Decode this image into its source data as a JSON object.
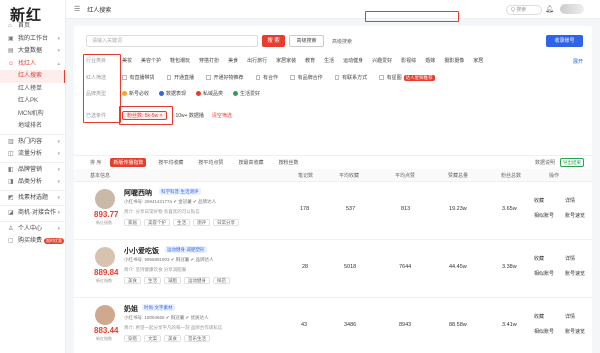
{
  "sidebar": {
    "logo": "新红",
    "items": [
      {
        "label": "首页",
        "icon": "home-icon",
        "caret": ""
      },
      {
        "label": "我的工作台",
        "icon": "desk-icon",
        "caret": "▾"
      },
      {
        "label": "大盘数据",
        "icon": "chart-icon",
        "caret": "▾"
      },
      {
        "label": "找红人",
        "icon": "user-icon",
        "caret": "▴",
        "active": true
      },
      {
        "label": "红人搜索",
        "sub": true,
        "current": true
      },
      {
        "label": "红人榜单",
        "sub": true
      },
      {
        "label": "红人PK",
        "sub": true
      },
      {
        "label": "MCN机构",
        "sub": true
      },
      {
        "label": "地域排名",
        "sub": true
      },
      {
        "label": "热门内容",
        "icon": "doc-icon",
        "caret": "▾"
      },
      {
        "label": "流量分析",
        "icon": "flow-icon",
        "caret": "▾"
      },
      {
        "label": "品牌营销",
        "icon": "brand-icon",
        "caret": "▾"
      },
      {
        "label": "品类分析",
        "icon": "category-icon",
        "caret": "▾"
      },
      {
        "label": "找素材选题",
        "icon": "material-icon",
        "caret": "▾"
      },
      {
        "label": "商机·对接合作",
        "icon": "deal-icon",
        "caret": "▾"
      },
      {
        "label": "个人中心",
        "icon": "person-icon",
        "caret": "▾"
      },
      {
        "label": "购买续费",
        "icon": "cart-icon",
        "caret": "",
        "badge": "限时优惠"
      }
    ]
  },
  "topbar": {
    "crumb": "红人搜索",
    "search_placeholder": "Q 搜索"
  },
  "search": {
    "placeholder": "请输入关键词",
    "search_btn": "搜 索",
    "advanced_btn": "高级搜索",
    "advanced_link": "高级搜索",
    "collect_btn": "收录账号"
  },
  "filters": {
    "industry_label": "行业类目",
    "industry_options": [
      "美妆",
      "美容个护",
      "鞋包潮玩",
      "穿搭打扮",
      "美食",
      "出行旅行",
      "家居家装",
      "教育",
      "生活",
      "运动健身",
      "兴趣爱好",
      "影视综",
      "婚嫁",
      "摄影摄像",
      "家居",
      "情感星座"
    ],
    "industry_more": "展开",
    "advanced_label": "红人筛选",
    "advanced_checks": [
      "有直播带货",
      "开通直播",
      "开通好物推荐",
      "有合作",
      "有品牌合作",
      "有联系方式",
      "有星图"
    ],
    "advanced_tag": "达人星探推荐",
    "platform_label": "品牌类型",
    "platforms": [
      {
        "label": "新号必收",
        "color": "#f5a623"
      },
      {
        "label": "数据表现",
        "color": "#2f64e8"
      },
      {
        "label": "私域品类",
        "color": "#e63d2e"
      },
      {
        "label": "生活爱好",
        "color": "#2aa44f"
      }
    ],
    "selected_label": "已选条件",
    "selected_chip": "粉丝数: 5k-5w ×",
    "chip2": "10w+ 数据播",
    "clear": "清空筛选"
  },
  "sort": {
    "label": "排  序",
    "options": [
      "新版传播指数",
      "按平均收藏",
      "按平均点赞",
      "按最高收藏",
      "按粉丝数"
    ],
    "data_info": "数据说明",
    "export": "导出结果"
  },
  "table": {
    "headers": [
      "基本信息",
      "笔记数",
      "平均收藏",
      "平均点赞",
      "赞藏总量",
      "粉丝总数",
      "操作"
    ],
    "rows": [
      {
        "name": "阿喔西呐",
        "category": "科学科普·生活测评",
        "meta": "小红书号: 2694142177a  ✔ 金冠薯  ✔ 品牌达人",
        "desc": "简介: 分享日常好物 有喜欢的可以私信",
        "tags": [
          "家居",
          "美容个护",
          "生活",
          "测评",
          "日常分享"
        ],
        "score": "893.77",
        "score_lbl": "新红指数",
        "notes": "178",
        "avg_fav": "537",
        "avg_like": "813",
        "total": "19.23w",
        "fans": "3.65w",
        "actions": [
          "收藏",
          "详情",
          "相似账号",
          "账号速览"
        ]
      },
      {
        "name": "小小爱吃饭",
        "category": "运动健身·减肥塑形",
        "meta": "小红书号: 9956891903  ✔ 铜冠薯  ✔ 品牌达人",
        "desc": "简介: 坚持健康饮食 分享减脂餐",
        "tags": [
          "美食",
          "生活",
          "减脂",
          "运动健身",
          "探店"
        ],
        "score": "889.84",
        "score_lbl": "新红指数",
        "notes": "28",
        "avg_fav": "5018",
        "avg_like": "7644",
        "total": "44.45w",
        "fans": "3.38w",
        "actions": [
          "收藏",
          "详情",
          "相似账号",
          "账号速览"
        ]
      },
      {
        "name": "奶姐",
        "category": "时尚·文字素材",
        "meta": "小红书号: 18094665  ✔ 铜冠薯  ✔ 优质达人",
        "desc": "简介: 希望一起分享平凡的每一刻 品牌合作请私信",
        "tags": [
          "穿搭",
          "文案",
          "美食",
          "音乐生活"
        ],
        "score": "883.44",
        "score_lbl": "新红指数",
        "notes": "43",
        "avg_fav": "3486",
        "avg_like": "8943",
        "total": "88.58w",
        "fans": "3.41w",
        "actions": [
          "收藏",
          "详情",
          "相似账号",
          "账号速览"
        ]
      }
    ]
  }
}
